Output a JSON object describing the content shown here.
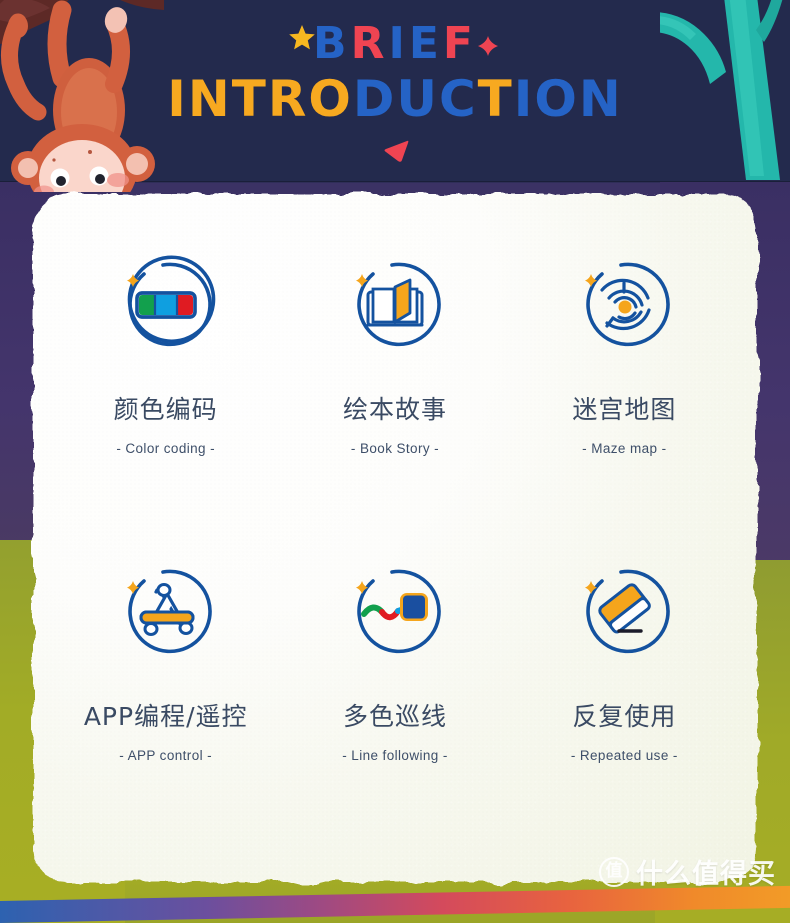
{
  "header": {
    "title_line1": "BRIEF",
    "title_line2": "INTRODUCTION",
    "line1_letters": [
      {
        "ch": "B",
        "color": "blue"
      },
      {
        "ch": "R",
        "color": "red"
      },
      {
        "ch": "I",
        "color": "blue"
      },
      {
        "ch": "E",
        "color": "blue"
      },
      {
        "ch": "F",
        "color": "red"
      }
    ],
    "line2_letters": [
      {
        "ch": "I",
        "color": "yellow"
      },
      {
        "ch": "N",
        "color": "yellow"
      },
      {
        "ch": "T",
        "color": "yellow"
      },
      {
        "ch": "R",
        "color": "yellow"
      },
      {
        "ch": "O",
        "color": "yellow"
      },
      {
        "ch": "D",
        "color": "blue"
      },
      {
        "ch": "U",
        "color": "blue"
      },
      {
        "ch": "C",
        "color": "blue"
      },
      {
        "ch": "T",
        "color": "yellow"
      },
      {
        "ch": "I",
        "color": "blue"
      },
      {
        "ch": "O",
        "color": "blue"
      },
      {
        "ch": "N",
        "color": "blue"
      }
    ],
    "decorations": [
      "star-yellow",
      "diamond-red",
      "triangle-red"
    ]
  },
  "colors": {
    "title_blue": "#2563c6",
    "title_red": "#ef4452",
    "title_yellow": "#f7a920",
    "icon_blue": "#14529f",
    "icon_orange": "#f5a51c",
    "bg_navy": "#232a4d",
    "bg_purple": "#44356c",
    "bg_olive": "#a2ac26",
    "card_white": "#fdfdfb",
    "text_slate": "#3a4a63"
  },
  "features": [
    {
      "icon": "color-coding-icon",
      "title": "颜色编码",
      "subtitle": "- Color coding -",
      "icon_colors": [
        "#12a04d",
        "#0f9fe0",
        "#e01b22"
      ]
    },
    {
      "icon": "book-story-icon",
      "title": "绘本故事",
      "subtitle": "- Book Story -",
      "icon_colors": [
        "#f5a51c"
      ]
    },
    {
      "icon": "maze-map-icon",
      "title": "迷宫地图",
      "subtitle": "- Maze map -",
      "icon_colors": [
        "#f5a51c"
      ]
    },
    {
      "icon": "app-control-icon",
      "title": "APP编程/遥控",
      "subtitle": "- APP control -",
      "icon_colors": [
        "#f5a51c"
      ]
    },
    {
      "icon": "line-following-icon",
      "title": "多色巡线",
      "subtitle": "- Line following -",
      "icon_colors": [
        "#12a04d",
        "#e01b22",
        "#1a4fa0",
        "#f5a51c"
      ]
    },
    {
      "icon": "repeated-use-icon",
      "title": "反复使用",
      "subtitle": "- Repeated use -",
      "icon_colors": [
        "#f5a51c"
      ]
    }
  ],
  "watermark": {
    "badge": "值",
    "text": "什么值得买"
  },
  "illustrations": {
    "top_left": "hanging-monkey",
    "top_right": "teal-cactus",
    "bottom": "rainbow-stripe"
  }
}
